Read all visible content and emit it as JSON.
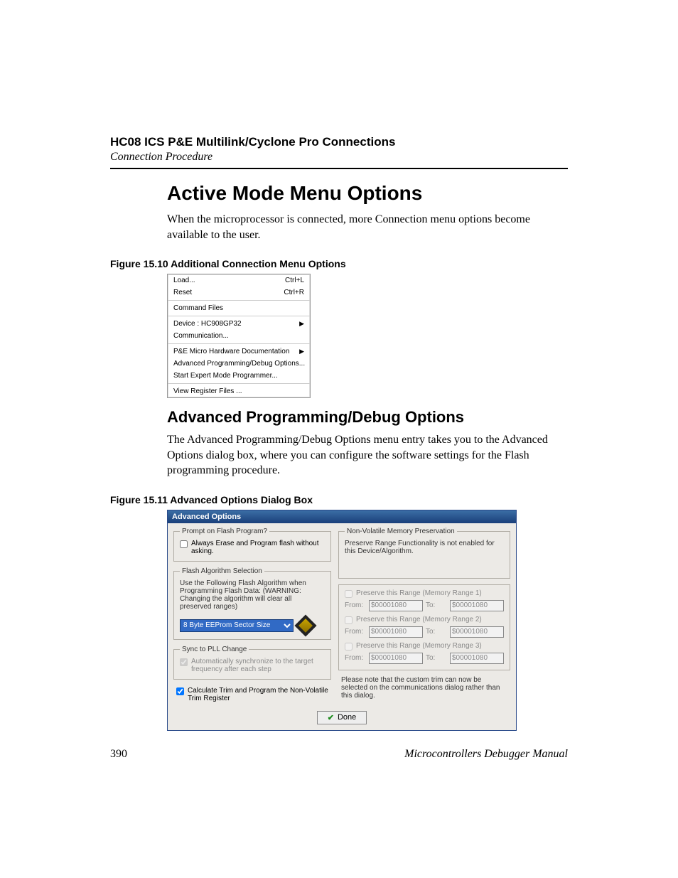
{
  "header": {
    "title": "HC08 ICS P&E Multilink/Cyclone Pro Connections",
    "subtitle": "Connection Procedure"
  },
  "section1": {
    "heading": "Active Mode Menu Options",
    "para": "When the microprocessor is connected, more Connection menu options become available to the user."
  },
  "fig10": {
    "caption": "Figure 15.10  Additional Connection Menu Options",
    "items": {
      "load": "Load...",
      "load_sc": "Ctrl+L",
      "reset": "Reset",
      "reset_sc": "Ctrl+R",
      "cmdfiles": "Command Files",
      "device": "Device : HC908GP32",
      "comm": "Communication...",
      "pedoc": "P&E Micro Hardware Documentation",
      "adv": "Advanced Programming/Debug Options...",
      "expert": "Start Expert Mode Programmer...",
      "viewreg": "View Register Files ..."
    }
  },
  "section2": {
    "heading": "Advanced Programming/Debug Options",
    "para": "The Advanced Programming/Debug Options menu entry takes you to the Advanced Options dialog box, where you can configure the software settings for the Flash programming procedure."
  },
  "fig11": {
    "caption": "Figure 15.11  Advanced Options Dialog Box",
    "title": "Advanced Options",
    "prompt_legend": "Prompt on Flash Program?",
    "prompt_cb": "Always Erase and Program flash without asking.",
    "algo_legend": "Flash Algorithm Selection",
    "algo_text": "Use the Following Flash Algorithm when Programming Flash Data: (WARNING: Changing the algorithm will clear all preserved ranges)",
    "algo_value": "8 Byte EEProm Sector Size",
    "sync_legend": "Sync to PLL Change",
    "sync_cb": "Automatically synchronize to the target frequency after each step",
    "trim_cb": "Calculate Trim and Program the Non-Volatile Trim Register",
    "nvm_legend": "Non-Volatile Memory Preservation",
    "nvm_note": "Preserve Range Functionality is not enabled for this Device/Algorithm.",
    "r1": "Preserve this Range (Memory Range 1)",
    "r2": "Preserve this Range (Memory Range 2)",
    "r3": "Preserve this Range (Memory Range 3)",
    "from": "From:",
    "to": "To:",
    "addr": "$00001080",
    "custom_note": "Please note that the custom trim can now be selected on the communications dialog rather than this dialog.",
    "done": "Done"
  },
  "footer": {
    "page": "390",
    "manual": "Microcontrollers Debugger Manual"
  }
}
